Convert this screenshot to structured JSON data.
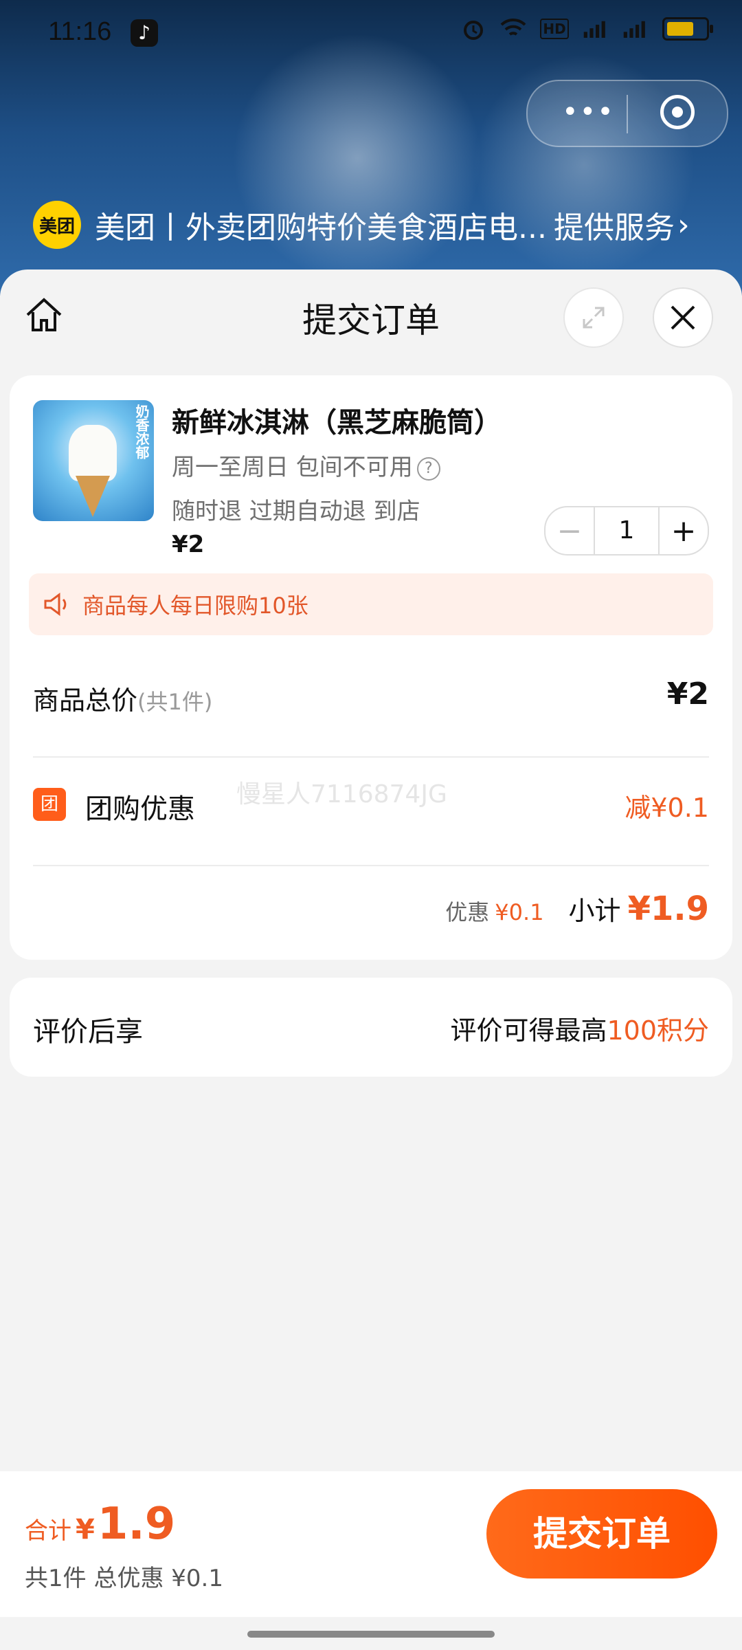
{
  "status_bar": {
    "time": "11:16",
    "app_icon": "tiktok-icon",
    "icons": [
      "alarm-icon",
      "wifi-icon",
      "hd-icon",
      "signal-5g-icon",
      "signal-4g-icon",
      "battery-icon"
    ]
  },
  "mini_program": {
    "capsule_icons": [
      "more-icon",
      "target-icon"
    ],
    "provider": {
      "logo_text": "美团",
      "name": "美团丨外卖团购特价美食酒店电...",
      "service": "提供服务",
      "chevron": "›"
    }
  },
  "navbar": {
    "title": "提交订单",
    "icons": [
      "home-icon",
      "expand-icon",
      "close-icon"
    ]
  },
  "product": {
    "image_text": "奶香浓郁",
    "name": "新鲜冰淇淋（黑芝麻脆筒）",
    "availability": "周一至周日 包间不可用",
    "refund_policy": "随时退 过期自动退 到店",
    "price": "¥2",
    "quantity": "1"
  },
  "notice": {
    "text": "商品每人每日限购10张",
    "icon": "speaker-icon"
  },
  "summary": {
    "total_label": "商品总价",
    "total_sub": "(共1件)",
    "total_value": "¥2",
    "discount_badge": "团",
    "discount_label": "团购优惠",
    "discount_value": "减¥0.1",
    "watermark": "慢星人7116874JG",
    "saving_label": "优惠",
    "saving_value": "¥0.1",
    "subtotal_label": "小计",
    "subtotal_value": "¥1.9"
  },
  "review": {
    "label": "评价后享",
    "text": "评价可得最高",
    "highlight": "100积分"
  },
  "footer": {
    "total_label": "合计",
    "currency": "¥",
    "total_value": "1.9",
    "sub": "共1件 总优惠 ¥0.1",
    "submit_label": "提交订单"
  },
  "colors": {
    "accent": "#ef5c22",
    "brand_yellow": "#ffd100"
  }
}
